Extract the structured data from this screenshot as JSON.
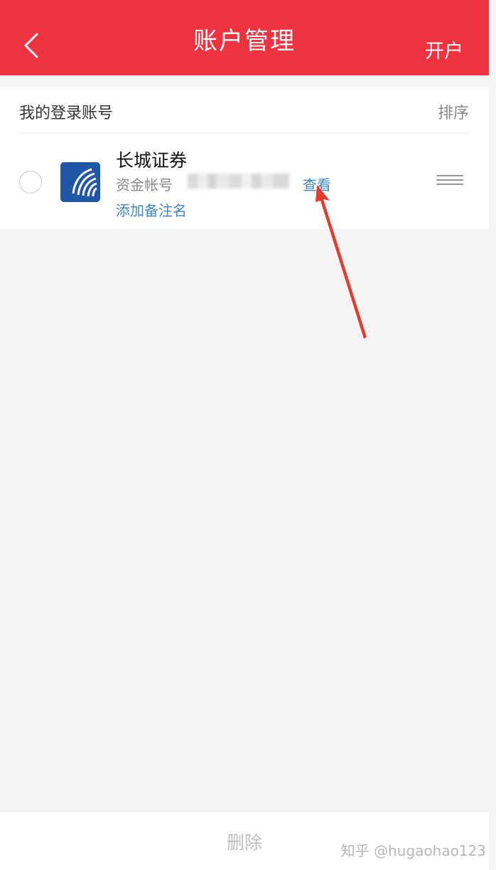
{
  "header": {
    "title": "账户管理",
    "back_icon": "chevron-left-icon",
    "open_account_label": "开户"
  },
  "accounts_section": {
    "title": "我的登录账号",
    "sort_label": "排序"
  },
  "accounts": [
    {
      "broker_name": "长城证券",
      "logo_icon": "great-wall-securities-logo",
      "account_label": "资金帐号",
      "view_label": "查看",
      "add_remark_label": "添加备注名"
    }
  ],
  "footer": {
    "delete_label": "删除"
  },
  "watermark": "知乎 @hugaohao123",
  "colors": {
    "header_bg": "#ef323f",
    "link": "#3f86c6",
    "annotation_arrow": "#e63a2e",
    "logo_blue": "#1f56a6"
  }
}
